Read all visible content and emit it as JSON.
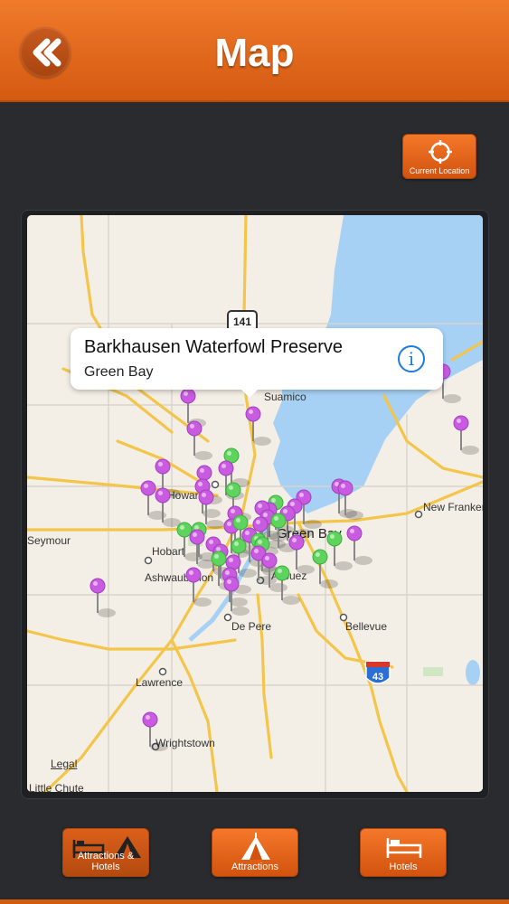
{
  "header": {
    "title": "Map"
  },
  "current_location_label": "Current Location",
  "map": {
    "callout": {
      "title": "Barkhausen Waterfowl Preserve",
      "subtitle": "Green Bay"
    },
    "places": {
      "suamico": "Suamico",
      "howard": "Howard",
      "seymour": "Seymour",
      "hobart": "Hobart",
      "ashwaubenon": "Ashwaubenon",
      "green_bay": "Green Bay",
      "allouez": "Allouez",
      "new_franken": "New Franken",
      "de_pere": "De Pere",
      "bellevue": "Bellevue",
      "lawrence": "Lawrence",
      "wrightstown": "Wrightstown",
      "little_chute": "Little Chute",
      "legal": "Legal"
    },
    "highway_141": "141",
    "interstate_43": "43",
    "colors": {
      "attraction_pin": "#c85be0",
      "hotel_pin": "#5ed35e",
      "water": "#a6d1f5",
      "road": "#f3c54a"
    }
  },
  "bottom_nav": {
    "attractions_hotels": "Attractions & Hotels",
    "attractions": "Attractions",
    "hotels": "Hotels"
  }
}
